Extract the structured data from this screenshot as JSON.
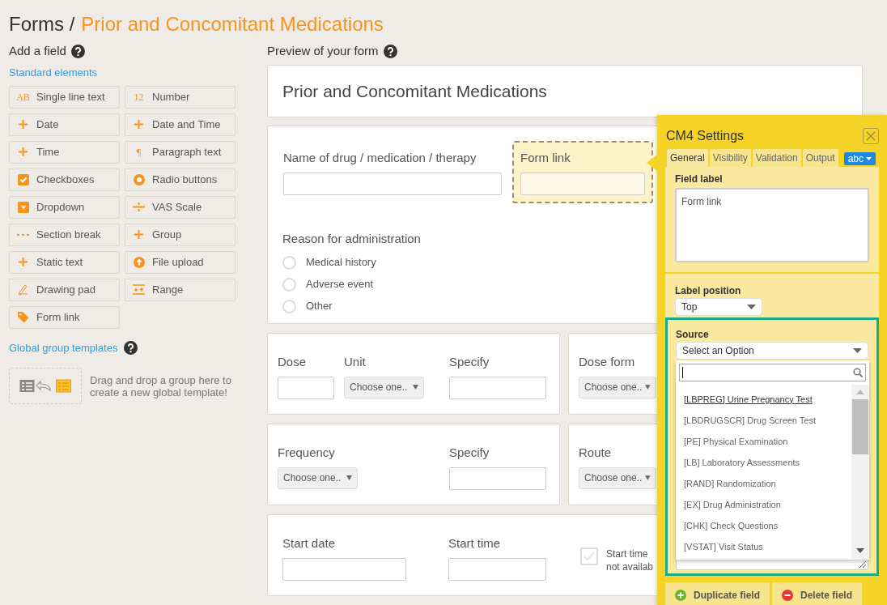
{
  "header": {
    "section": "Forms /",
    "title": "Prior and Concomitant Medications"
  },
  "sidebar": {
    "heading": "Add a field",
    "standard_link": "Standard elements",
    "elements": [
      {
        "kind": "text",
        "label": "Single line text",
        "glyph": "AB"
      },
      {
        "kind": "number",
        "label": "Number",
        "glyph": "12"
      },
      {
        "kind": "plus",
        "label": "Date"
      },
      {
        "kind": "plus",
        "label": "Date and Time"
      },
      {
        "kind": "plus",
        "label": "Time"
      },
      {
        "kind": "paragraph",
        "label": "Paragraph text",
        "glyph": "¶"
      },
      {
        "kind": "checkbox",
        "label": "Checkboxes"
      },
      {
        "kind": "radio",
        "label": "Radio buttons"
      },
      {
        "kind": "dropdown",
        "label": "Dropdown"
      },
      {
        "kind": "vas",
        "label": "VAS Scale"
      },
      {
        "kind": "dots",
        "label": "Section break"
      },
      {
        "kind": "plus",
        "label": "Group"
      },
      {
        "kind": "plus",
        "label": "Static text"
      },
      {
        "kind": "upload",
        "label": "File upload"
      },
      {
        "kind": "pencil",
        "label": "Drawing pad"
      },
      {
        "kind": "range",
        "label": "Range"
      },
      {
        "kind": "tag",
        "label": "Form link"
      }
    ],
    "templates_link": "Global group templates",
    "dropzone_text": "Drag and drop a group here to create a new global template!"
  },
  "preview": {
    "heading": "Preview of your form",
    "form_title": "Prior and Concomitant Medications",
    "main_card": {
      "fields": [
        {
          "label": "Name of drug / medication / therapy",
          "selected": false
        },
        {
          "label": "Form link",
          "selected": true
        }
      ],
      "radio_group": {
        "label": "Reason for administration",
        "options": [
          {
            "label": "Medical history",
            "selected": false
          },
          {
            "label": "Adverse event",
            "selected": false
          },
          {
            "label": "Other",
            "selected": false
          }
        ]
      }
    },
    "rows": [
      {
        "cards": [
          {
            "fields": [
              {
                "kind": "input",
                "label": "Dose"
              },
              {
                "kind": "select",
                "label": "Unit",
                "value": "Choose one.."
              },
              {
                "kind": "input",
                "label": "Specify"
              }
            ]
          },
          {
            "fields": [
              {
                "kind": "select",
                "label": "Dose form",
                "value": "Choose one.."
              }
            ]
          }
        ]
      },
      {
        "cards": [
          {
            "fields": [
              {
                "kind": "select",
                "label": "Frequency",
                "value": "Choose one.."
              },
              {
                "kind": "input",
                "label": "Specify"
              }
            ]
          },
          {
            "fields": [
              {
                "kind": "select",
                "label": "Route",
                "value": "Choose one.."
              }
            ]
          }
        ]
      },
      {
        "cards": [
          {
            "fields": [
              {
                "kind": "input",
                "label": "Start date"
              },
              {
                "kind": "input",
                "label": "Start time"
              },
              {
                "kind": "checkbox",
                "label": "Start time not availab",
                "checked": false
              }
            ]
          }
        ]
      }
    ]
  },
  "settings": {
    "title": "CM4 Settings",
    "tabs": [
      {
        "label": "General",
        "selected": true
      },
      {
        "label": "Visibility",
        "selected": false
      },
      {
        "label": "Validation",
        "selected": false
      },
      {
        "label": "Output",
        "selected": false
      }
    ],
    "language_button": "abc",
    "field_label": {
      "label": "Field label",
      "value": "Form link"
    },
    "label_position": {
      "label": "Label position",
      "value": "Top"
    },
    "source": {
      "label": "Source",
      "value": "Select an Option",
      "options": [
        {
          "label": "[LBPREG] Urine Pregnancy Test",
          "selected": true
        },
        {
          "label": "[LBDRUGSCR] Drug Screen Test",
          "selected": false
        },
        {
          "label": "[PE] Physical Examination",
          "selected": false
        },
        {
          "label": "[LB] Laboratory Assessments",
          "selected": false
        },
        {
          "label": "[RAND] Randomization",
          "selected": false
        },
        {
          "label": "[EX] Drug Administration",
          "selected": false
        },
        {
          "label": "[CHK] Check Questions",
          "selected": false
        },
        {
          "label": "[VSTAT] Visit Status",
          "selected": false
        }
      ]
    },
    "buttons": [
      {
        "kind": "duplicate",
        "label": "Duplicate field"
      },
      {
        "kind": "delete",
        "label": "Delete field"
      }
    ]
  }
}
